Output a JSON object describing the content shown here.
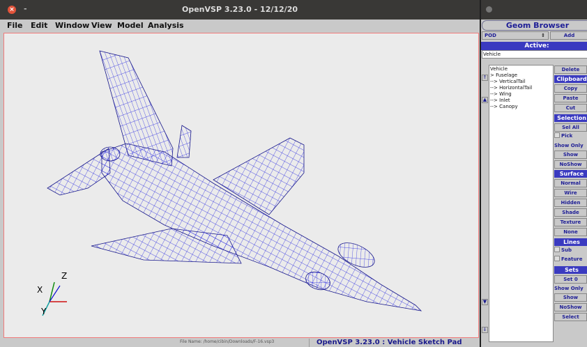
{
  "main_window": {
    "title": "OpenVSP 3.23.0 - 12/12/20",
    "close_glyph": "×",
    "minimize_glyph": "-",
    "menu": [
      "File",
      "Edit",
      "Window",
      "View",
      "Model",
      "Analysis"
    ],
    "status_file": "File Name: /home/cibin/Downloads/F-16.vsp3",
    "status_title": "OpenVSP 3.23.0 : Vehicle Sketch Pad",
    "axes": {
      "x": "X",
      "y": "Y",
      "z": "Z"
    },
    "model_icon": "f16-wireframe-model",
    "wire_color": "#1a1ad6"
  },
  "geom_browser": {
    "title": "Geom Browser",
    "type_select": "POD",
    "add_label": "Add",
    "active_label": "Active:",
    "active_value": "Vehicle",
    "tree": [
      "Vehicle",
      "> Fuselage",
      "--> VerticalTail",
      "--> HorizontalTail",
      "--> Wing",
      "--> Inlet",
      "--> Canopy"
    ],
    "buttons": {
      "delete": "Delete",
      "clipboard": "Clipboard",
      "copy": "Copy",
      "paste": "Paste",
      "cut": "Cut",
      "selection": "Selection",
      "sel_all": "Sel All",
      "pick": "Pick",
      "show_only": "Show Only",
      "show": "Show",
      "noshow": "NoShow",
      "surface": "Surface",
      "normal": "Normal",
      "wire": "Wire",
      "hidden": "Hidden",
      "shade": "Shade",
      "texture": "Texture",
      "none": "None",
      "lines": "Lines",
      "sub": "Sub",
      "feature": "Feature",
      "sets": "Sets",
      "set0": "Set 0",
      "show_only2": "Show Only",
      "show2": "Show",
      "noshow2": "NoShow",
      "select": "Select"
    },
    "accent": "#3a3ac0"
  }
}
